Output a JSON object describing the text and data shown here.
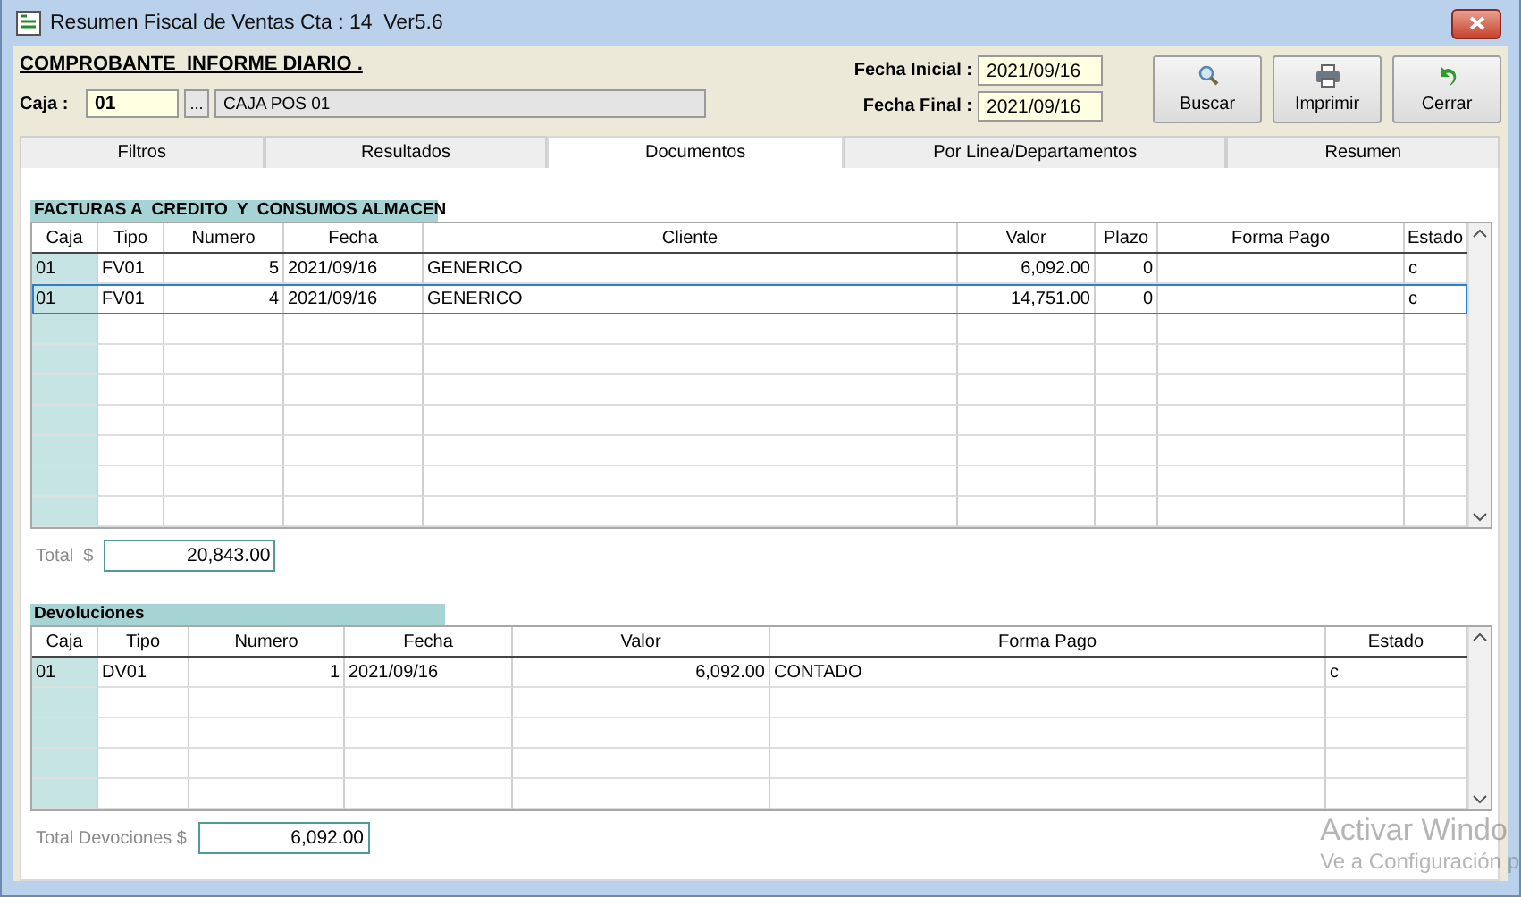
{
  "window": {
    "title": "Resumen Fiscal de Ventas Cta : 14  Ver5.6"
  },
  "report_title": "COMPROBANTE  INFORME DIARIO .",
  "caja": {
    "label": "Caja :",
    "value": "01",
    "browse": "...",
    "description": "CAJA POS 01"
  },
  "fecha_inicial": {
    "label": "Fecha Inicial :",
    "value": "2021/09/16"
  },
  "fecha_final": {
    "label": "Fecha Final :",
    "value": "2021/09/16"
  },
  "buttons": [
    {
      "label": "Buscar",
      "kind": "search"
    },
    {
      "label": "Imprimir",
      "kind": "print"
    },
    {
      "label": "Cerrar",
      "kind": "close"
    }
  ],
  "tabs": [
    {
      "label": "Filtros",
      "selected": false
    },
    {
      "label": "Resultados",
      "selected": false
    },
    {
      "label": "Documentos",
      "selected": true
    },
    {
      "label": "Por Linea/Departamentos",
      "selected": false
    },
    {
      "label": "Resumen",
      "selected": false
    }
  ],
  "facturas": {
    "title": "FACTURAS A  CREDITO  Y  CONSUMOS ALMACEN",
    "columns": [
      "Caja",
      "Tipo",
      "Numero",
      "Fecha",
      "Cliente",
      "Valor",
      "Plazo",
      "Forma Pago",
      "Estado"
    ],
    "rows": [
      {
        "cells": [
          "01",
          "FV01",
          "5",
          "2021/09/16",
          "GENERICO",
          "6,092.00",
          "0",
          "",
          "c"
        ],
        "selected": false
      },
      {
        "cells": [
          "01",
          "FV01",
          "4",
          "2021/09/16",
          "GENERICO",
          "14,751.00",
          "0",
          "",
          "c"
        ],
        "selected": true
      }
    ],
    "total_label": "Total  $",
    "total": "20,843.00"
  },
  "devoluciones": {
    "title": "Devoluciones",
    "columns": [
      "Caja",
      "Tipo",
      "Numero",
      "Fecha",
      "Valor",
      "Forma Pago",
      "Estado"
    ],
    "rows": [
      {
        "cells": [
          "01",
          "DV01",
          "1",
          "2021/09/16",
          "6,092.00",
          "CONTADO",
          "c"
        ],
        "selected": false
      }
    ],
    "total_label": "Total Devociones $",
    "total": "6,092.00"
  },
  "watermark": [
    "Activar Windo",
    "Ve a Configuración p"
  ]
}
